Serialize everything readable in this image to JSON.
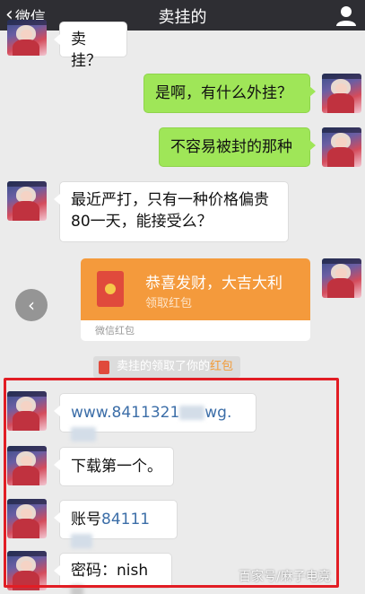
{
  "nav": {
    "back_label": "微信",
    "title": "卖挂的"
  },
  "messages": {
    "m0": "卖挂？",
    "m1": "是啊，有什么外挂？",
    "m2": "不容易被封的那种",
    "m3_line1": "最近严打，只有一种价格偏贵",
    "m3_line2": "80一天，能接受么？",
    "m4_prefix": "www.8411321",
    "m4_mid": "wg.",
    "m5": "下载第一个。",
    "m6_label": "账号",
    "m6_value": "84111",
    "m7_label": "密码：",
    "m7_value": "nish"
  },
  "red_packet": {
    "title": "恭喜发财，大吉大利",
    "subtitle": "领取红包",
    "brand": "微信红包"
  },
  "system_notice": {
    "text": "卖挂的领取了你的",
    "highlight": "红包"
  },
  "watermark": "百家号/麻子电竞",
  "colors": {
    "nav_bg": "#2e2e33",
    "chat_bg": "#ebebeb",
    "right_bubble": "#9fe658",
    "red_packet": "#f49a3c",
    "highlight_box": "#e21d24",
    "link": "#3c6ea8"
  },
  "icons": {
    "back": "chevron-left-icon",
    "profile": "person-icon",
    "side": "chevron-left-circle-icon",
    "packet": "red-packet-icon"
  }
}
